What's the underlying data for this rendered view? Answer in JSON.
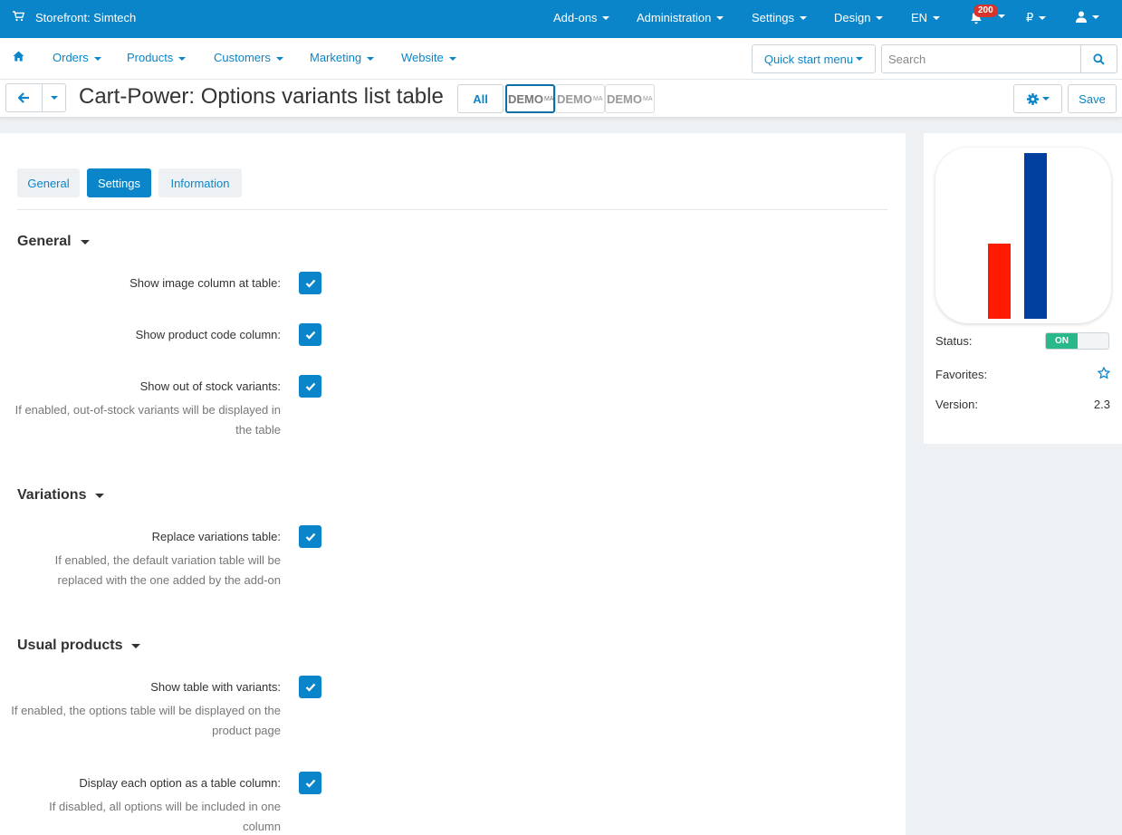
{
  "topbar": {
    "store_label": "Storefront: Simtech",
    "menus": [
      "Add-ons",
      "Administration",
      "Settings",
      "Design",
      "EN"
    ],
    "notifications_count": "200",
    "currency": "₽",
    "colors": {
      "bar": "#0b85c9",
      "badge": "#d9342b"
    }
  },
  "navbar": {
    "items": [
      "Orders",
      "Products",
      "Customers",
      "Marketing",
      "Website"
    ],
    "quick_start_label": "Quick start menu",
    "search_placeholder": "Search"
  },
  "titlebar": {
    "title": "Cart-Power: Options variants list table",
    "all_label": "All",
    "demo_labels": [
      "DEMO",
      "DEMO",
      "DEMO"
    ],
    "demo_sup": "MA",
    "save_label": "Save"
  },
  "tabs": [
    {
      "label": "General",
      "active": false
    },
    {
      "label": "Settings",
      "active": true
    },
    {
      "label": "Information",
      "active": false
    }
  ],
  "sections": {
    "general": {
      "title": "General",
      "settings": [
        {
          "label": "Show image column at table:",
          "checked": true
        },
        {
          "label": "Show product code column:",
          "checked": true
        },
        {
          "label": "Show out of stock variants:",
          "checked": true,
          "hint": "If enabled, out-of-stock variants will be displayed in the table"
        }
      ]
    },
    "variations": {
      "title": "Variations",
      "settings": [
        {
          "label": "Replace variations table:",
          "checked": true,
          "hint": "If enabled, the default variation table will be replaced with the one added by the add-on"
        }
      ]
    },
    "usual_products": {
      "title": "Usual products",
      "settings": [
        {
          "label": "Show table with variants:",
          "checked": true,
          "hint": "If enabled, the options table will be displayed on the product page"
        },
        {
          "label": "Display each option as a table column:",
          "checked": true,
          "hint": "If disabled, all options will be included in one column"
        }
      ]
    }
  },
  "sidebar": {
    "logo_colors": {
      "short_bar": "#ff1a00",
      "tall_bar": "#003f9e"
    },
    "status_label": "Status:",
    "status_value": "ON",
    "favorites_label": "Favorites:",
    "version_label": "Version:",
    "version_value": "2.3"
  }
}
